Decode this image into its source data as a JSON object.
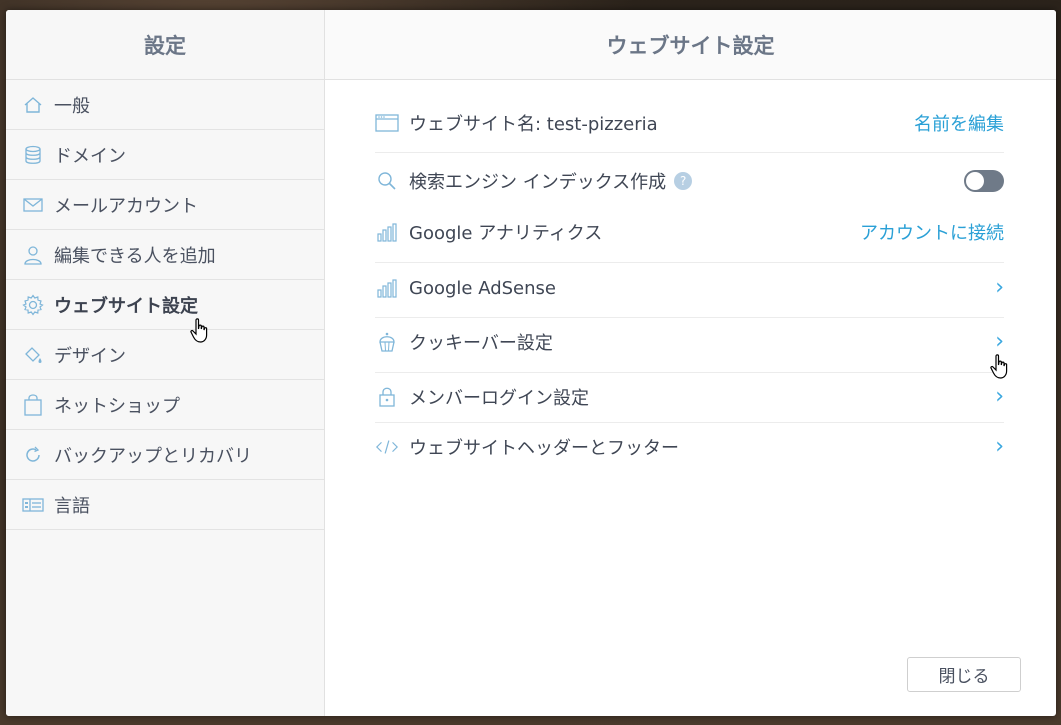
{
  "sidebar": {
    "title": "設定",
    "items": [
      {
        "label": "一般",
        "icon": "home-icon"
      },
      {
        "label": "ドメイン",
        "icon": "database-icon"
      },
      {
        "label": "メールアカウント",
        "icon": "mail-icon"
      },
      {
        "label": "編集できる人を追加",
        "icon": "user-icon"
      },
      {
        "label": "ウェブサイト設定",
        "icon": "gear-icon",
        "active": true
      },
      {
        "label": "デザイン",
        "icon": "paint-bucket-icon"
      },
      {
        "label": "ネットショップ",
        "icon": "shopping-bag-icon"
      },
      {
        "label": "バックアップとリカバリ",
        "icon": "refresh-icon"
      },
      {
        "label": "言語",
        "icon": "language-icon"
      }
    ]
  },
  "main": {
    "title": "ウェブサイト設定",
    "rows": [
      {
        "label": "ウェブサイト名: test-pizzeria",
        "icon": "browser-window-icon",
        "action": "名前を編集"
      },
      {
        "label": "検索エンジン インデックス作成",
        "icon": "search-icon",
        "help": "?",
        "toggle": false
      },
      {
        "label": "Google アナリティクス",
        "icon": "bar-chart-icon",
        "action": "アカウントに接続"
      },
      {
        "label": "Google AdSense",
        "icon": "bar-chart-icon",
        "chevron": "›"
      },
      {
        "label": "クッキーバー設定",
        "icon": "cupcake-icon",
        "chevron": "›"
      },
      {
        "label": "メンバーログイン設定",
        "icon": "lock-icon",
        "chevron": "›"
      },
      {
        "label": "ウェブサイトヘッダーとフッター",
        "icon": "code-icon",
        "chevron": "›"
      }
    ],
    "close_label": "閉じる"
  },
  "colors": {
    "accent": "#2aa0d6",
    "icon": "#7fb6d9",
    "text": "#3f4654"
  }
}
